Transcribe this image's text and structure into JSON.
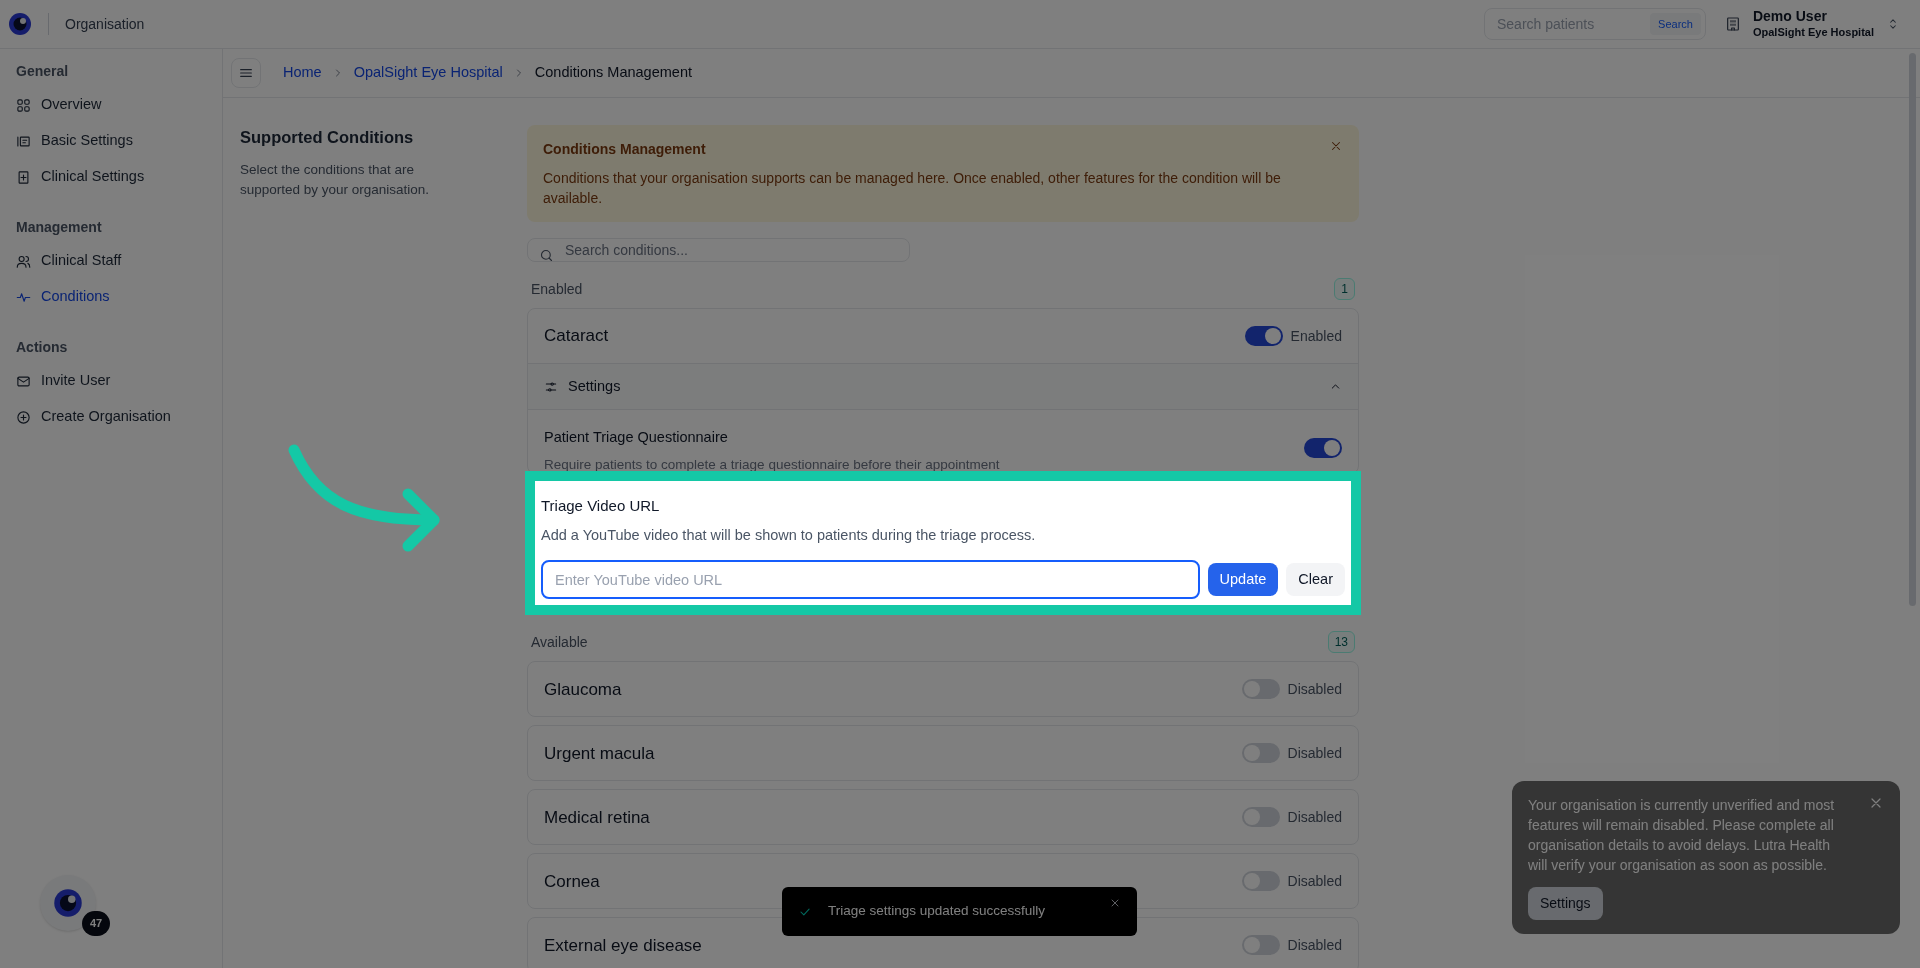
{
  "header": {
    "title": "Organisation",
    "search": {
      "placeholder": "Search patients",
      "button": "Search"
    },
    "user": {
      "name": "Demo User",
      "organisation": "OpalSight Eye Hospital"
    }
  },
  "sidebar": {
    "sections": [
      {
        "heading": "General",
        "items": [
          {
            "label": "Overview",
            "selected": false
          },
          {
            "label": "Basic Settings",
            "selected": false
          },
          {
            "label": "Clinical Settings",
            "selected": false
          }
        ]
      },
      {
        "heading": "Management",
        "items": [
          {
            "label": "Clinical Staff",
            "selected": false
          },
          {
            "label": "Conditions",
            "selected": true
          }
        ]
      },
      {
        "heading": "Actions",
        "items": [
          {
            "label": "Invite User",
            "selected": false
          },
          {
            "label": "Create Organisation",
            "selected": false
          }
        ]
      }
    ]
  },
  "breadcrumb": [
    {
      "label": "Home",
      "kind": "link"
    },
    {
      "label": "OpalSight Eye Hospital",
      "kind": "link"
    },
    {
      "label": "Conditions Management",
      "kind": "current"
    }
  ],
  "intro": {
    "title": "Supported Conditions",
    "description": "Select the conditions that are supported by your organisation."
  },
  "banner": {
    "title": "Conditions Management",
    "text": "Conditions that your organisation supports can be managed here. Once enabled, other features for the condition will be available."
  },
  "search": {
    "placeholder": "Search conditions..."
  },
  "enabled": {
    "heading": "Enabled",
    "count": "1",
    "conditions": [
      {
        "name": "Cataract",
        "on": true,
        "status": "Enabled",
        "settings": {
          "label": "Settings",
          "expanded": true,
          "questionnaire": {
            "title": "Patient Triage Questionnaire",
            "description": "Require patients to complete a triage questionnaire before their appointment",
            "on": true
          }
        }
      }
    ]
  },
  "highlight": {
    "title": "Triage Video URL",
    "description": "Add a YouTube video that will be shown to patients during the triage process.",
    "placeholder": "Enter YouTube video URL",
    "buttons": [
      {
        "label": "Update",
        "kind": "primary"
      },
      {
        "label": "Clear",
        "kind": "secondary"
      }
    ]
  },
  "available": {
    "heading": "Available",
    "count": "13",
    "conditions": [
      {
        "name": "Glaucoma",
        "on": false,
        "status": "Disabled"
      },
      {
        "name": "Urgent macula",
        "on": false,
        "status": "Disabled"
      },
      {
        "name": "Medical retina",
        "on": false,
        "status": "Disabled"
      },
      {
        "name": "Cornea",
        "on": false,
        "status": "Disabled"
      },
      {
        "name": "External eye disease",
        "on": false,
        "status": "Disabled"
      }
    ]
  },
  "success_toast": {
    "message": "Triage settings updated successfully"
  },
  "notice_toast": {
    "text": "Your organisation is currently unverified and most features will remain disabled. Please complete all organisation details to avoid delays. Lutra Health will verify your organisation as soon as possible.",
    "button": "Settings"
  },
  "assistant": {
    "badge": "47"
  }
}
